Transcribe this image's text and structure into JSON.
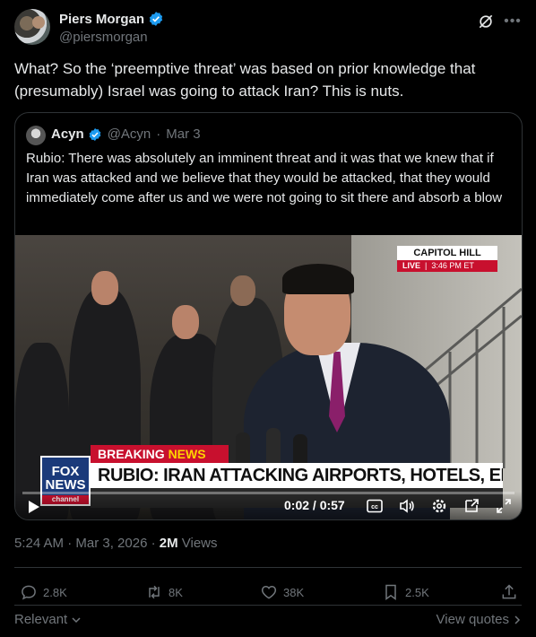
{
  "author": {
    "name": "Piers Morgan",
    "handle": "@piersmorgan"
  },
  "tweet": {
    "text": "What? So the ‘preemptive threat’ was based on prior knowledge that (presumably) Israel was going to attack Iran? This is nuts."
  },
  "quoted": {
    "name": "Acyn",
    "handle": "@Acyn",
    "date": "Mar 3",
    "text": "Rubio: There was absolutely an imminent threat and it was that we knew that if Iran was attacked and we believe that they would be attacked, that they would immediately come after us and we were not going to sit there and absorb a blow",
    "video": {
      "location_label": "CAPITOL HILL",
      "live_label": "LIVE",
      "live_time": "3:46 PM ET",
      "breaking_white": "BREAKING",
      "breaking_yellow": "NEWS",
      "headline": "RUBIO: IRAN ATTACKING AIRPORTS, HOTELS, EMBASSIES",
      "logo_top": "FOX",
      "logo_mid": "NEWS",
      "logo_sub": "channel",
      "time": "0:02 / 0:57"
    }
  },
  "meta": {
    "timestamp": "5:24 AM · Mar 3, 2026 · ",
    "views_count": "2M",
    "views_label": " Views"
  },
  "actions": {
    "replies": "2.8K",
    "reposts": "8K",
    "likes": "38K",
    "bookmarks": "2.5K"
  },
  "footer": {
    "relevant": "Relevant",
    "view_quotes": "View quotes"
  },
  "colors": {
    "verified_blue": "#1d9bf0",
    "muted": "#71767b",
    "text": "#e7e9ea",
    "fox_red": "#c8102e"
  }
}
